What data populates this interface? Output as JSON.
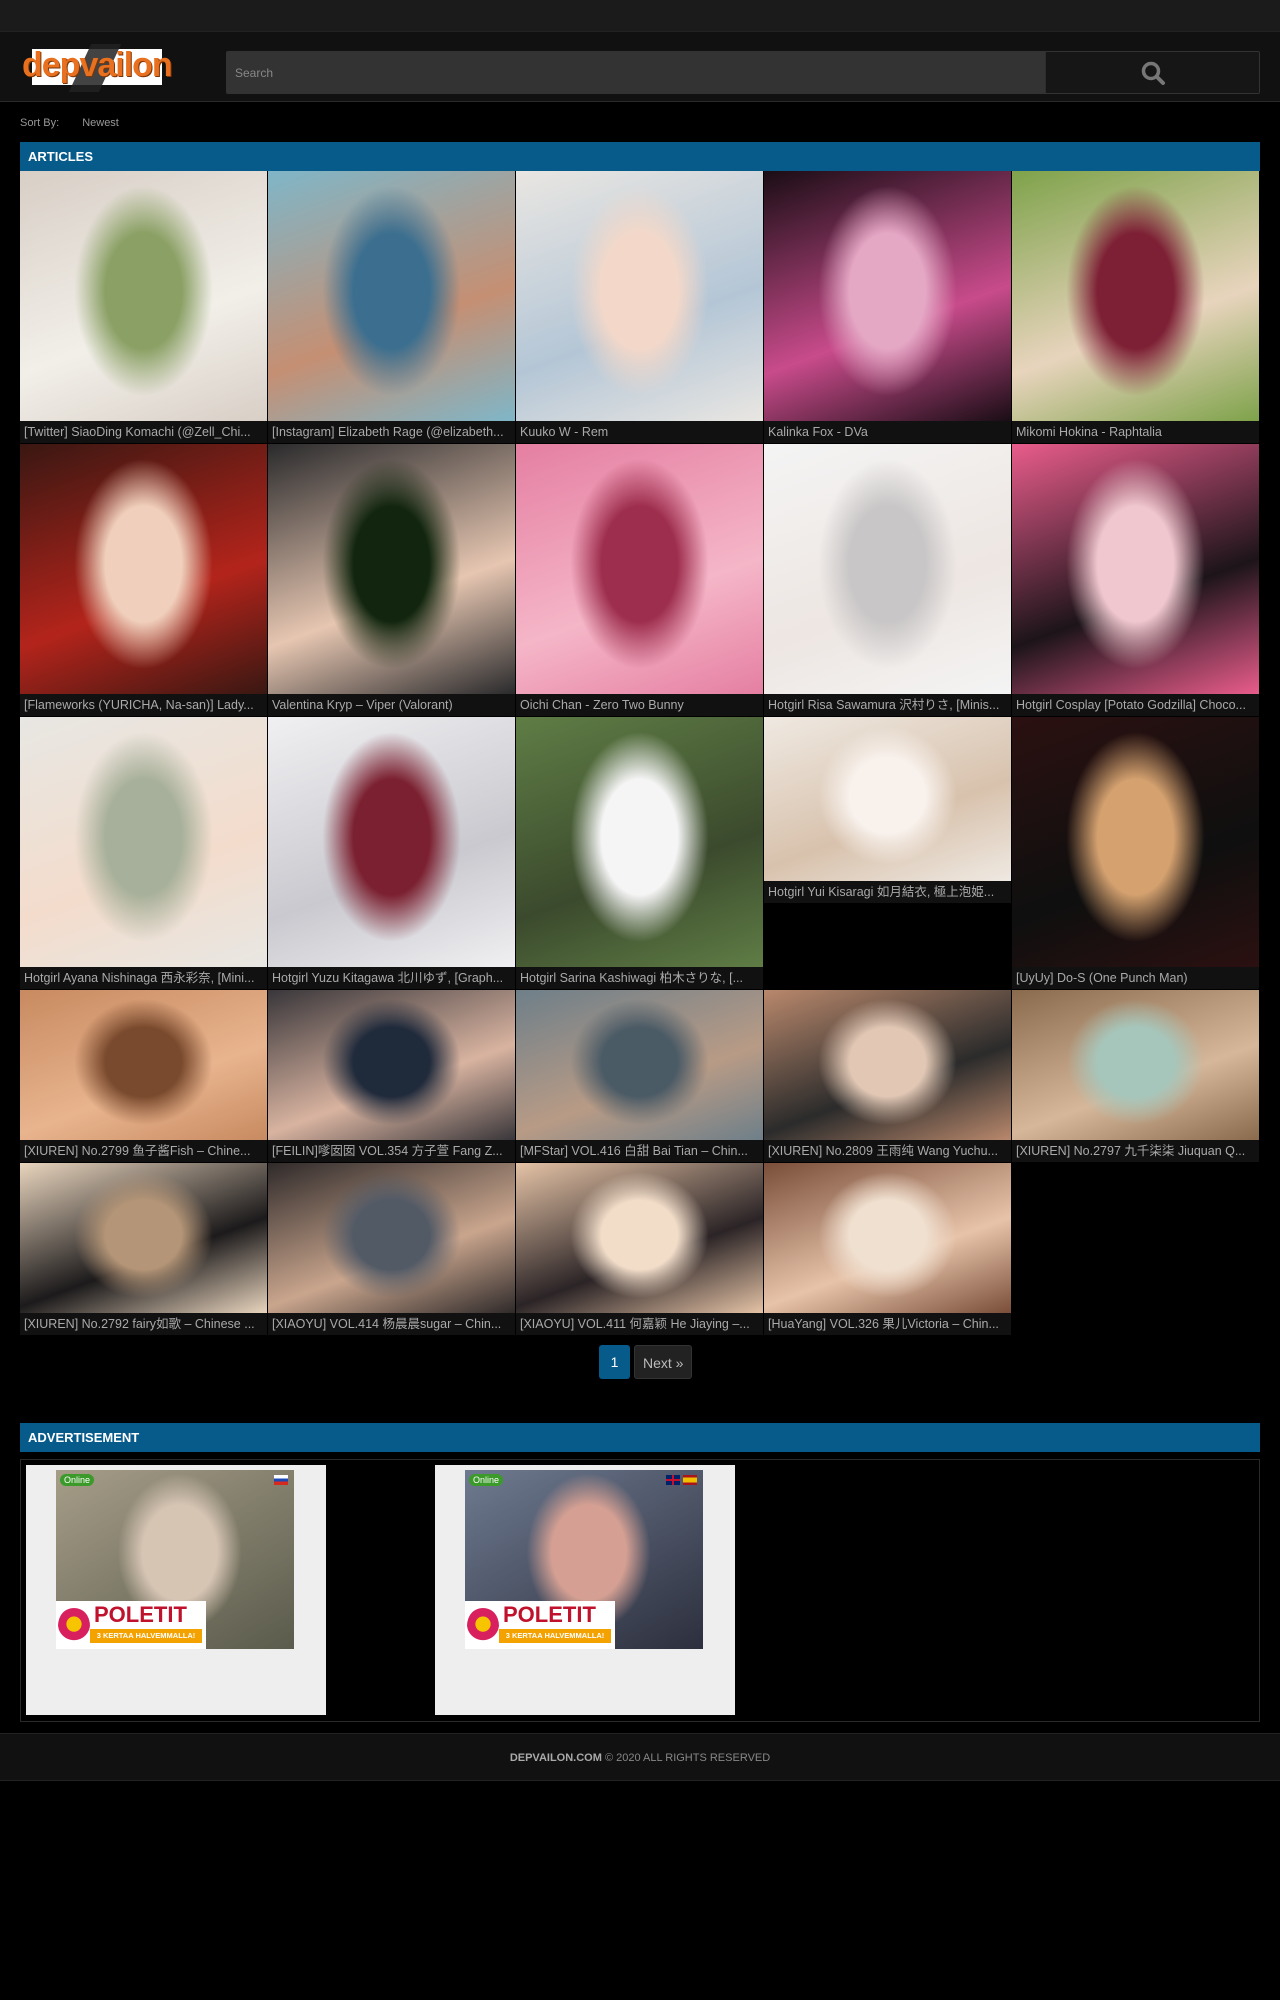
{
  "header": {
    "logo_text": "depvailon",
    "search_placeholder": "Search"
  },
  "sort": {
    "label": "Sort By:",
    "value": "Newest"
  },
  "articles": {
    "title": "ARTICLES",
    "items": [
      {
        "caption": "[Twitter] SiaoDing Komachi (@Zell_Chi...",
        "colors": [
          "#d8cfc6",
          "#f2efe9",
          "#8aa064"
        ]
      },
      {
        "caption": "[Instagram] Elizabeth Rage (@elizabeth...",
        "colors": [
          "#7fb6c8",
          "#c58f73",
          "#3c6f8f"
        ]
      },
      {
        "caption": "Kuuko W - Rem",
        "colors": [
          "#e9e6e2",
          "#b4c6d6",
          "#f3d8c9"
        ]
      },
      {
        "caption": "Kalinka Fox - DVa",
        "colors": [
          "#1a0d15",
          "#c84b8b",
          "#e4a7c4"
        ]
      },
      {
        "caption": "Mikomi Hokina - Raphtalia",
        "colors": [
          "#7ea24a",
          "#e8d4bd",
          "#7d2035"
        ]
      },
      {
        "caption": "[Flameworks (YURICHA, Na-san)] Lady...",
        "colors": [
          "#3a1712",
          "#b3241b",
          "#f0d0bc"
        ]
      },
      {
        "caption": "Valentina Kryp – Viper (Valorant)",
        "colors": [
          "#2a2a2c",
          "#e6c6b1",
          "#12260f"
        ]
      },
      {
        "caption": "Oichi Chan - Zero Two Bunny",
        "colors": [
          "#e57fa2",
          "#f5b6c8",
          "#9e2e4e"
        ]
      },
      {
        "caption": "Hotgirl Risa Sawamura 沢村りさ, [Minis...",
        "colors": [
          "#f4f4f4",
          "#ede6e2",
          "#c9c6c7"
        ]
      },
      {
        "caption": "Hotgirl Cosplay [Potato Godzilla] Choco...",
        "colors": [
          "#e95c8c",
          "#1c1419",
          "#f0c7cf"
        ]
      },
      {
        "caption": "Hotgirl Ayana Nishinaga 西永彩奈, [Mini...",
        "colors": [
          "#e8e7e3",
          "#f3dccc",
          "#a7b09a"
        ]
      },
      {
        "caption": "Hotgirl Yuzu Kitagawa 北川ゆず, [Graph...",
        "colors": [
          "#f0f0f2",
          "#c9c9cf",
          "#7b2030"
        ]
      },
      {
        "caption": "Hotgirl Sarina Kashiwagi 柏木さりな, [...",
        "colors": [
          "#5f7d45",
          "#3b4a2d",
          "#f5f5f5"
        ]
      },
      {
        "caption": "Hotgirl Yui Kisaragi 如月結衣, 極上泡姫...",
        "colors": [
          "#efe9e2",
          "#d8c2ad",
          "#f8f1ec"
        ]
      },
      {
        "caption": "[UyUy] Do-S (One Punch Man)",
        "colors": [
          "#2b1010",
          "#0f0f0f",
          "#d4a16f"
        ]
      },
      {
        "caption": "[XIUREN] No.2799 鱼子酱Fish – Chine...",
        "colors": [
          "#c88a60",
          "#e8b48e",
          "#7a4a2e"
        ]
      },
      {
        "caption": "[FEILIN]嗲囡囡 VOL.354 方子萱 Fang Z...",
        "colors": [
          "#39363a",
          "#d8b3a0",
          "#1f2a3b"
        ]
      },
      {
        "caption": "[MFStar] VOL.416 白甜 Bai Tian – Chin...",
        "colors": [
          "#6e7f89",
          "#b89b86",
          "#4b5b66"
        ]
      },
      {
        "caption": "[XIUREN] No.2809 王雨纯 Wang Yuchu...",
        "colors": [
          "#b9886c",
          "#2b2b2b",
          "#e1c7b4"
        ]
      },
      {
        "caption": "[XIUREN] No.2797 九千柒柒 Jiuquan Q...",
        "colors": [
          "#8a6a4c",
          "#d6b79a",
          "#a6c6bb"
        ]
      },
      {
        "caption": "[XIUREN] No.2792 fairy如歌 – Chinese ...",
        "colors": [
          "#e9d5be",
          "#1c1a1b",
          "#b49577"
        ]
      },
      {
        "caption": "[XIAOYU] VOL.414 杨晨晨sugar – Chin...",
        "colors": [
          "#2f2a2a",
          "#c9a58d",
          "#525a66"
        ]
      },
      {
        "caption": "[XIAOYU] VOL.411 何嘉颖 He Jiaying –...",
        "colors": [
          "#e5c3a6",
          "#2b2426",
          "#f2ddc9"
        ]
      },
      {
        "caption": "[HuaYang] VOL.326 果儿Victoria – Chin...",
        "colors": [
          "#7a4e3a",
          "#e7c3a9",
          "#f0e0d0"
        ]
      }
    ]
  },
  "pagination": {
    "current": "1",
    "next": "Next »"
  },
  "advertisement": {
    "title": "ADVERTISEMENT",
    "ads": [
      {
        "status": "Online",
        "brand": "POLETIT",
        "tagline": "3 KERTAA HALVEMMALLA!",
        "colors": [
          "#a69d88",
          "#d7c5b4",
          "#5a5b4c"
        ],
        "flags": [
          "ru"
        ]
      },
      {
        "status": "Online",
        "brand": "POLETIT",
        "tagline": "3 KERTAA HALVEMMALLA!",
        "colors": [
          "#6e7a90",
          "#d5a093",
          "#2c2f3d"
        ],
        "flags": [
          "gb",
          "es"
        ]
      }
    ]
  },
  "footer": {
    "site": "DEPVAILON.COM",
    "copyright": "© 2020 ALL RIGHTS RESERVED"
  }
}
